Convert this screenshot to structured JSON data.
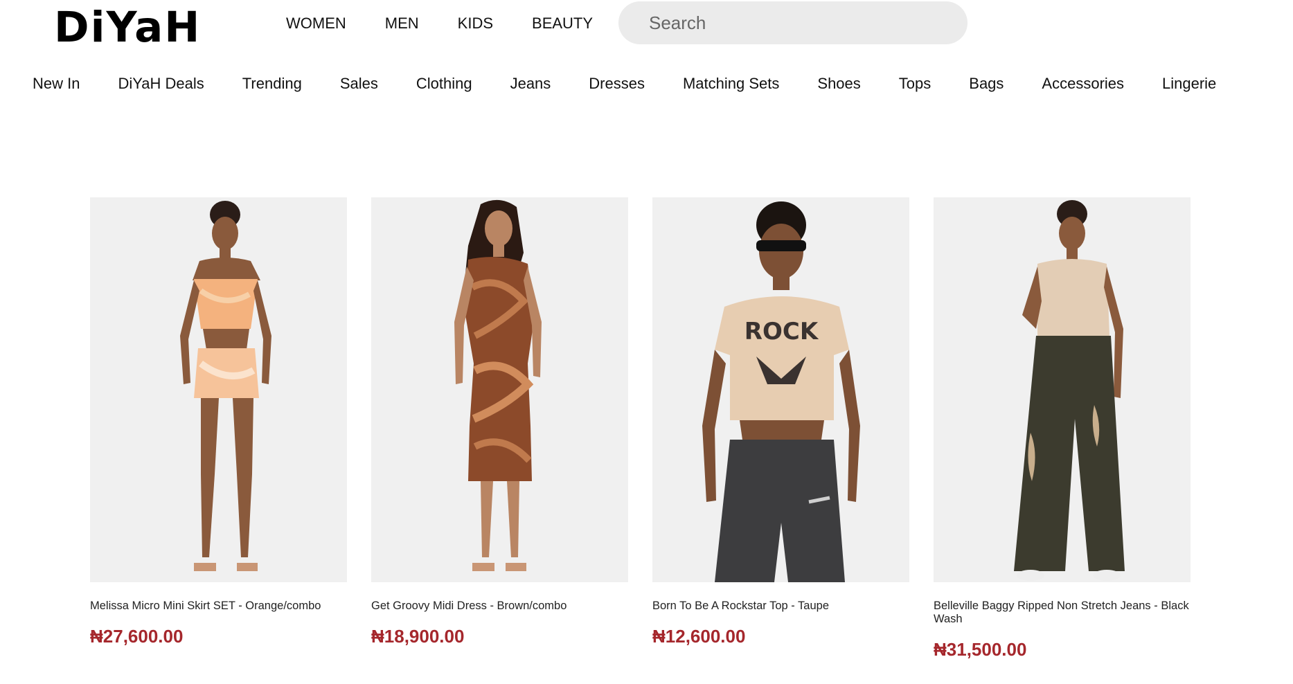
{
  "brand": {
    "logo_text": "DiYaH"
  },
  "main_nav": [
    "WOMEN",
    "MEN",
    "KIDS",
    "BEAUTY"
  ],
  "search": {
    "placeholder": "Search"
  },
  "category_nav": [
    "New In",
    "DiYaH Deals",
    "Trending",
    "Sales",
    "Clothing",
    "Jeans",
    "Dresses",
    "Matching Sets",
    "Shoes",
    "Tops",
    "Bags",
    "Accessories",
    "Lingerie"
  ],
  "products": [
    {
      "name": "Melissa Micro Mini Skirt SET - Orange/combo",
      "price": "₦27,600.00",
      "image_icon": "product-photo-skirt-set"
    },
    {
      "name": "Get Groovy Midi Dress - Brown/combo",
      "price": "₦18,900.00",
      "image_icon": "product-photo-midi-dress"
    },
    {
      "name": "Born To Be A Rockstar Top - Taupe",
      "price": "₦12,600.00",
      "image_icon": "product-photo-graphic-top"
    },
    {
      "name": "Belleville Baggy Ripped Non Stretch Jeans - Black Wash",
      "price": "₦31,500.00",
      "image_icon": "product-photo-baggy-jeans"
    }
  ],
  "colors": {
    "price": "#a5272c",
    "search_bg": "#ebebeb",
    "photo_bg": "#f0f0f0"
  }
}
